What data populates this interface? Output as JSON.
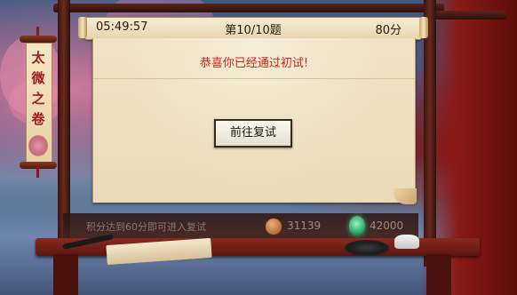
{
  "header": {
    "time": "05:49:57",
    "question_progress": "第10/10题",
    "score": "80分"
  },
  "panel": {
    "message": "恭喜你已经通过初试!",
    "retest_button_label": "前往复试"
  },
  "banner": {
    "title_chars": [
      "太",
      "微",
      "之",
      "卷"
    ]
  },
  "footer": {
    "hint": "积分达到60分即可进入复试",
    "coin_amount": "31139",
    "jade_amount": "42000"
  },
  "colors": {
    "message_red": "#c8251c",
    "banner_red": "#a3191a",
    "frame_wood": "#6b2a20"
  },
  "icons": [
    "coin-icon",
    "jade-icon"
  ]
}
